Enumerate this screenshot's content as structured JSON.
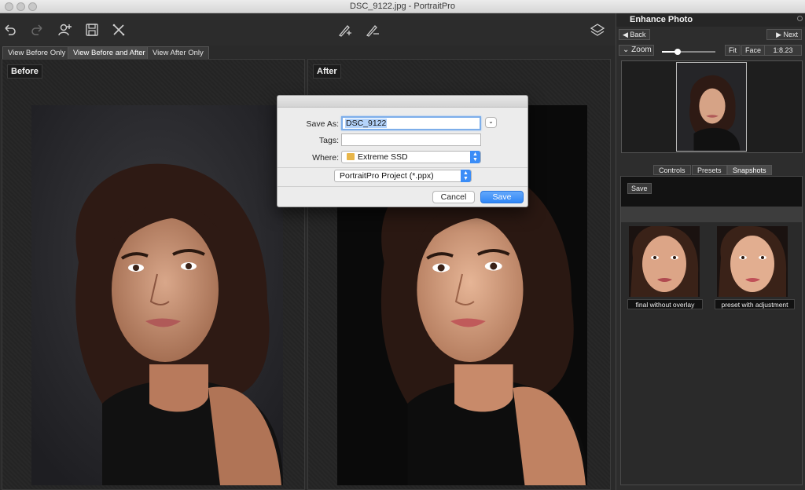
{
  "window": {
    "title": "DSC_9122.jpg - PortraitPro"
  },
  "toolbar": {
    "icons": [
      "undo-icon",
      "redo-icon",
      "add-person-icon",
      "save-disk-icon",
      "close-x-icon",
      "brush-add-icon",
      "brush-remove-icon",
      "layers-icon"
    ]
  },
  "view_tabs": [
    {
      "label": "View Before Only",
      "active": false
    },
    {
      "label": "View Before and After",
      "active": true
    },
    {
      "label": "View After Only",
      "active": false
    }
  ],
  "panes": {
    "before_label": "Before",
    "after_label": "After"
  },
  "save_dialog": {
    "save_as_label": "Save As:",
    "save_as_value": "DSC_9122",
    "tags_label": "Tags:",
    "tags_value": "",
    "where_label": "Where:",
    "where_value": "Extreme SSD",
    "format_value": "PortraitPro Project (*.ppx)",
    "cancel_label": "Cancel",
    "save_label": "Save"
  },
  "right_panel": {
    "title": "Enhance Photo",
    "back_label": "Back",
    "next_label": "Next",
    "zoom_label": "Zoom",
    "zoom_level": 0.3,
    "fit_label": "Fit",
    "face_label": "Face",
    "zoom_ratio": "1:8.23",
    "tabs": [
      {
        "label": "Controls",
        "active": false
      },
      {
        "label": "Presets",
        "active": false
      },
      {
        "label": "Snapshots",
        "active": true
      }
    ],
    "snapshot_save_label": "Save",
    "snapshots": [
      {
        "label": "final without overlay"
      },
      {
        "label": "preset with adjustment"
      }
    ]
  },
  "colors": {
    "accent_blue": "#2f86f6",
    "selection_blue": "#b3d3fb",
    "panel_dark": "#2d2d2d"
  }
}
